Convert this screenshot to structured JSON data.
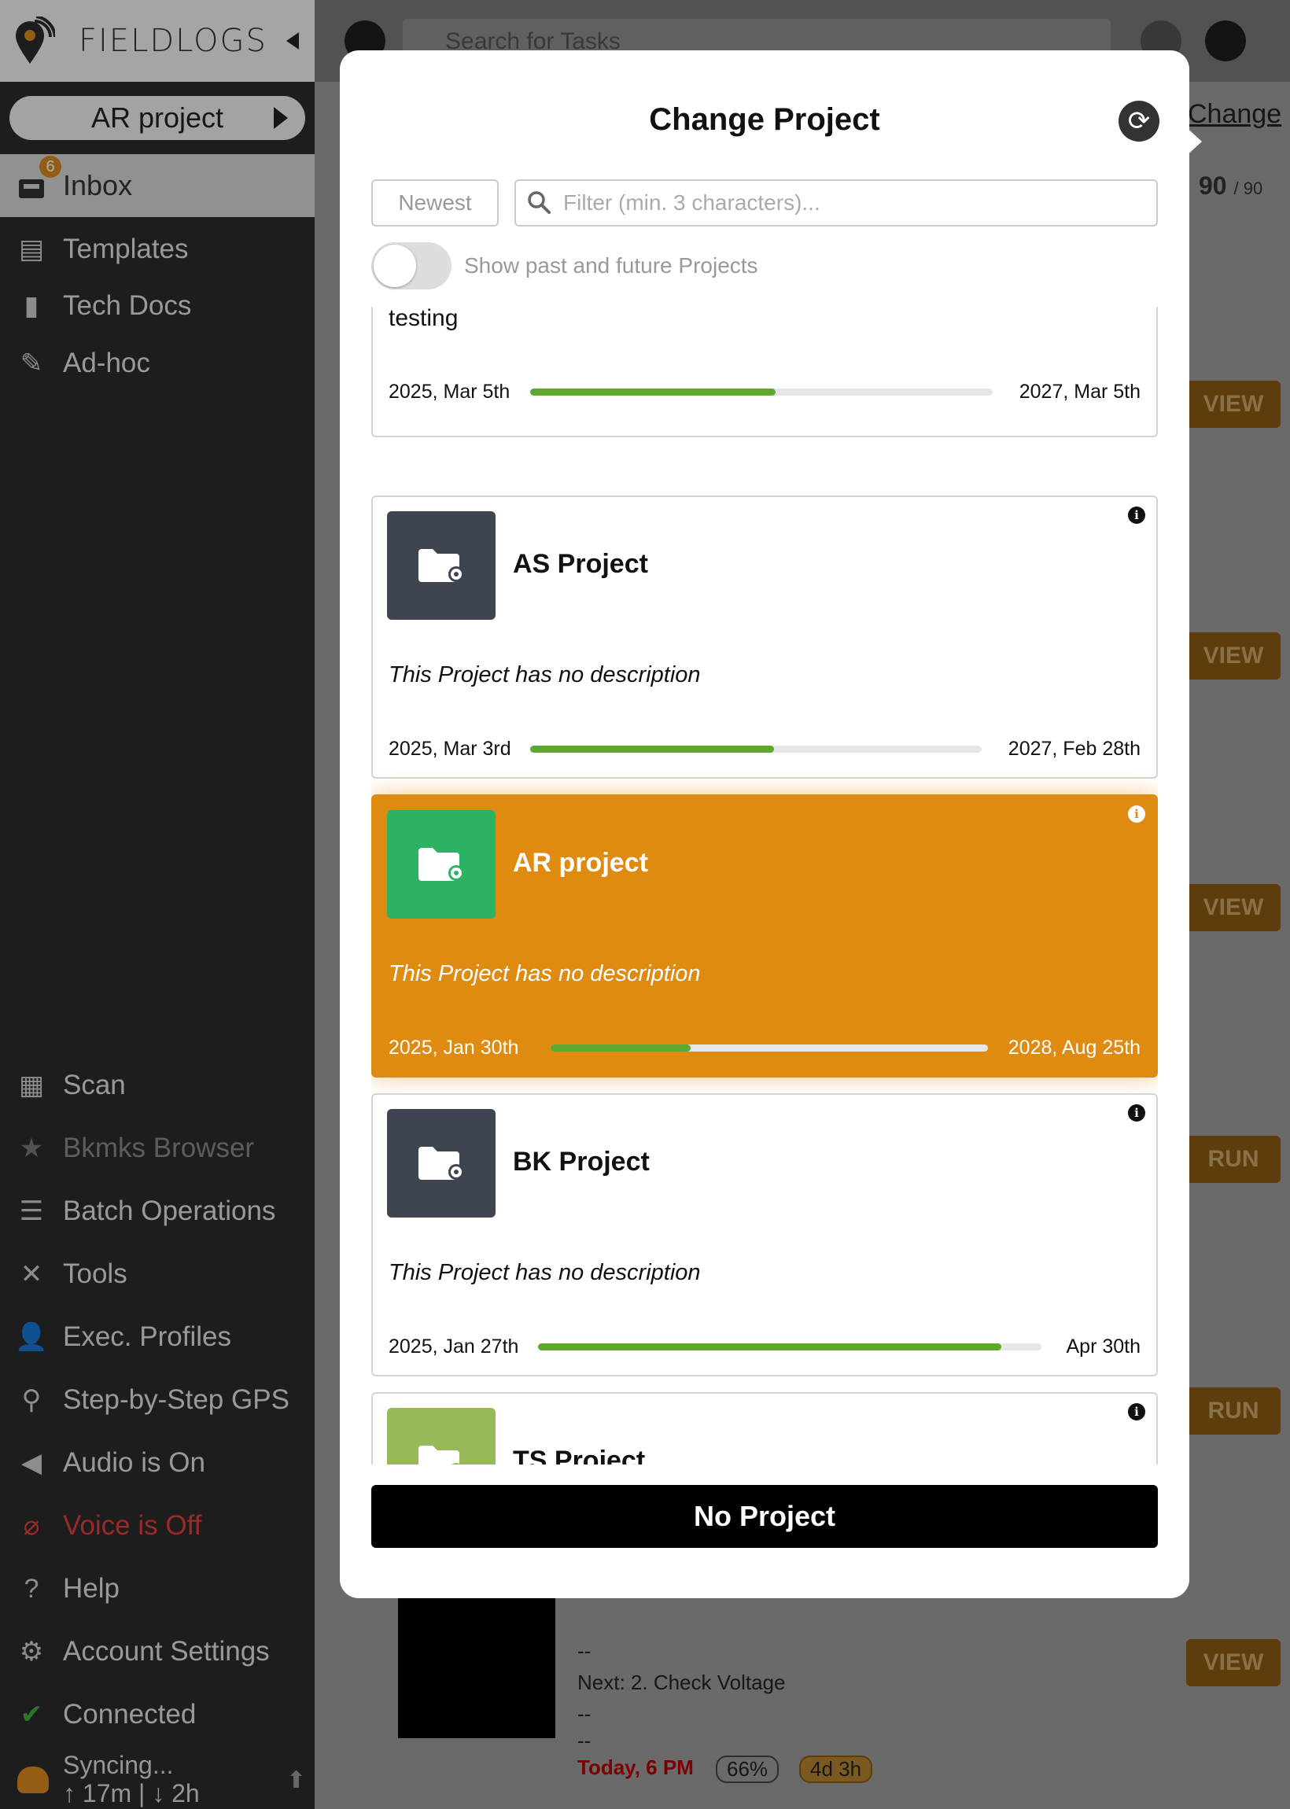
{
  "app": {
    "logo_text": "FIELDLOGS",
    "current_project": "AR project",
    "search_placeholder": "Search for Tasks"
  },
  "sidebar": {
    "inbox": {
      "label": "Inbox",
      "badge": "6"
    },
    "items": [
      {
        "label": "Templates",
        "icon": "clipboard-icon"
      },
      {
        "label": "Tech Docs",
        "icon": "book-icon"
      },
      {
        "label": "Ad-hoc",
        "icon": "pencil-icon"
      },
      {
        "label": "Scan",
        "icon": "qr-icon"
      },
      {
        "label": "Bkmks Browser",
        "icon": "star-icon"
      },
      {
        "label": "Batch Operations",
        "icon": "server-icon"
      },
      {
        "label": "Tools",
        "icon": "tools-icon"
      },
      {
        "label": "Exec. Profiles",
        "icon": "user-gear-icon"
      },
      {
        "label": "Step-by-Step GPS",
        "icon": "map-pin-icon"
      },
      {
        "label": "Audio is On",
        "icon": "speaker-icon"
      },
      {
        "label": "Voice is Off",
        "icon": "mic-off-icon"
      },
      {
        "label": "Help",
        "icon": "help-icon"
      },
      {
        "label": "Account Settings",
        "icon": "gear-icon"
      },
      {
        "label": "Connected",
        "icon": "check-icon"
      }
    ],
    "sync": {
      "line1": "Syncing...",
      "line2": "↑ 17m | ↓ 2h"
    }
  },
  "background": {
    "change_link": "Change",
    "count": "90",
    "count_total": "/ 90",
    "buttons": [
      "VIEW",
      "VIEW",
      "VIEW",
      "RUN",
      "RUN",
      "VIEW"
    ],
    "task_next": "Next: 2. Check Voltage",
    "task_time": "Today, 6 PM",
    "task_pct": "66%",
    "task_due": "4d 3h",
    "dash": "--"
  },
  "modal": {
    "title": "Change Project",
    "sort_label": "Newest",
    "filter_placeholder": "Filter (min. 3 characters)...",
    "toggle_label": "Show past and future Projects",
    "toggle_on": false,
    "projects": [
      {
        "name": "",
        "description": "testing",
        "start": "2025, Mar 5th",
        "end": "2027, Mar 5th",
        "progress": 0.53,
        "thumb_color": "",
        "selected": false
      },
      {
        "name": "AS Project",
        "description": "This Project has no description",
        "start": "2025, Mar 3rd",
        "end": "2027, Feb 28th",
        "progress": 0.54,
        "thumb_color": "#3e4550",
        "selected": false
      },
      {
        "name": "AR project",
        "description": "This Project has no description",
        "start": "2025, Jan 30th",
        "end": "2028, Aug 25th",
        "progress": 0.32,
        "thumb_color": "#2bb263",
        "selected": true
      },
      {
        "name": "BK Project",
        "description": "This Project has no description",
        "start": "2025, Jan 27th",
        "end": "Apr 30th",
        "progress": 0.92,
        "thumb_color": "#3e4550",
        "selected": false
      },
      {
        "name": "TS Project",
        "description": "",
        "start": "",
        "end": "",
        "progress": 0,
        "thumb_color": "#98b95a",
        "selected": false
      }
    ],
    "no_project_label": "No Project"
  }
}
